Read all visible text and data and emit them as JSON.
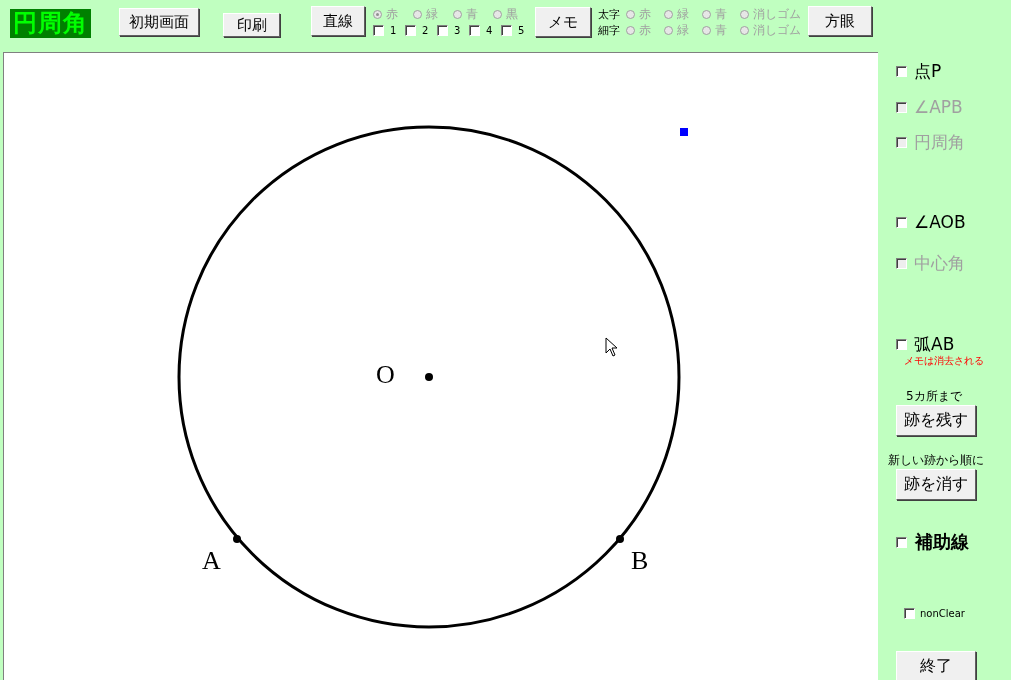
{
  "title": "円周角",
  "toolbar": {
    "reset_button": "初期画面",
    "print_button": "印刷",
    "line_button": "直線",
    "line_colors": {
      "disabled": true,
      "options": [
        {
          "label": "赤",
          "selected": true
        },
        {
          "label": "緑",
          "selected": false
        },
        {
          "label": "青",
          "selected": false
        },
        {
          "label": "黒",
          "selected": false
        }
      ]
    },
    "line_slots": [
      {
        "label": "1",
        "checked": false
      },
      {
        "label": "2",
        "checked": false
      },
      {
        "label": "3",
        "checked": false
      },
      {
        "label": "4",
        "checked": false
      },
      {
        "label": "5",
        "checked": false
      }
    ],
    "memo_button": "メモ",
    "memo_rows": [
      {
        "label": "太字",
        "disabled": true,
        "options": [
          {
            "label": "赤",
            "selected": false
          },
          {
            "label": "緑",
            "selected": false
          },
          {
            "label": "青",
            "selected": false
          },
          {
            "label": "消しゴム",
            "selected": false
          }
        ]
      },
      {
        "label": "細字",
        "disabled": true,
        "options": [
          {
            "label": "赤",
            "selected": false
          },
          {
            "label": "緑",
            "selected": false
          },
          {
            "label": "青",
            "selected": false
          },
          {
            "label": "消しゴム",
            "selected": false
          }
        ]
      }
    ],
    "grid_button": "方眼"
  },
  "canvas": {
    "points": [
      {
        "label": "O"
      },
      {
        "label": "A"
      },
      {
        "label": "B"
      }
    ]
  },
  "side": [
    {
      "kind": "checkbox",
      "label": "点P",
      "checked": false,
      "disabled": false
    },
    {
      "kind": "checkbox",
      "label": "∠APB",
      "checked": false,
      "disabled": true
    },
    {
      "kind": "checkbox",
      "label": "円周角",
      "checked": false,
      "disabled": true
    },
    {
      "kind": "checkbox",
      "label": "∠AOB",
      "checked": false,
      "disabled": false
    },
    {
      "kind": "checkbox",
      "label": "中心角",
      "checked": false,
      "disabled": true
    },
    {
      "kind": "checkbox",
      "label": "弧AB",
      "checked": false,
      "disabled": false
    },
    {
      "kind": "note",
      "label": "メモは消去される"
    },
    {
      "kind": "caption",
      "label": "5カ所まで"
    },
    {
      "kind": "button",
      "label": "跡を残す"
    },
    {
      "kind": "caption",
      "label": "新しい跡から順に"
    },
    {
      "kind": "button",
      "label": "跡を消す"
    },
    {
      "kind": "checkbox",
      "label": "補助線",
      "checked": false,
      "disabled": false
    },
    {
      "kind": "small-checkbox",
      "label": "nonClear",
      "checked": false,
      "disabled": false
    },
    {
      "kind": "button",
      "label": "終了"
    }
  ]
}
